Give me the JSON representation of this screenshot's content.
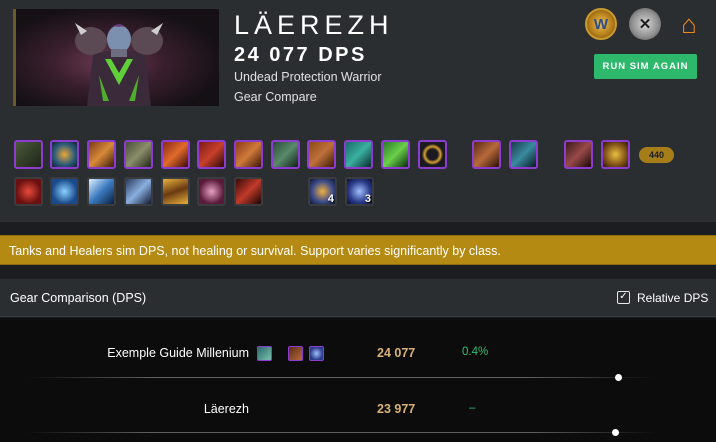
{
  "character": {
    "name": "LÄEREZH",
    "dps": "24 077 DPS",
    "spec": "Undead Protection Warrior",
    "mode": "Gear Compare"
  },
  "header_actions": {
    "wow_icon_glyph": "W",
    "raid_icon_glyph": "✕",
    "home_icon_glyph": "⌂",
    "run_sim_label": "RUN SIM AGAIN"
  },
  "gear": {
    "item_level": "440",
    "row1_slots": [
      "helm",
      "amulet",
      "shoulders",
      "cloak",
      "chest",
      "wrist",
      "gloves",
      "belt",
      "legs",
      "boots",
      "ring",
      "ring",
      "trinket",
      "trinket",
      "weapon",
      "shield"
    ],
    "row2_talents": [
      "talent-1",
      "talent-2",
      "talent-3",
      "talent-4",
      "talent-5",
      "talent-6",
      "talent-7"
    ],
    "stack_counts": [
      "4",
      "3"
    ]
  },
  "warning": {
    "text": "Tanks and Healers sim DPS, not healing or survival. Support varies significantly by class."
  },
  "comparison": {
    "title": "Gear Comparison (DPS)",
    "relative_label": "Relative DPS",
    "relative_checked": "✓",
    "rows": [
      {
        "name": "Exemple Guide Millenium",
        "dps": "24 077",
        "diff": "0.4%"
      },
      {
        "name": "Läerezh",
        "dps": "23 977",
        "diff": "–"
      }
    ]
  },
  "colors": {
    "accent_green": "#2db86b",
    "warning": "#b58a13",
    "epic_border": "#8c3ccf",
    "dps_value": "#d8b27a"
  }
}
